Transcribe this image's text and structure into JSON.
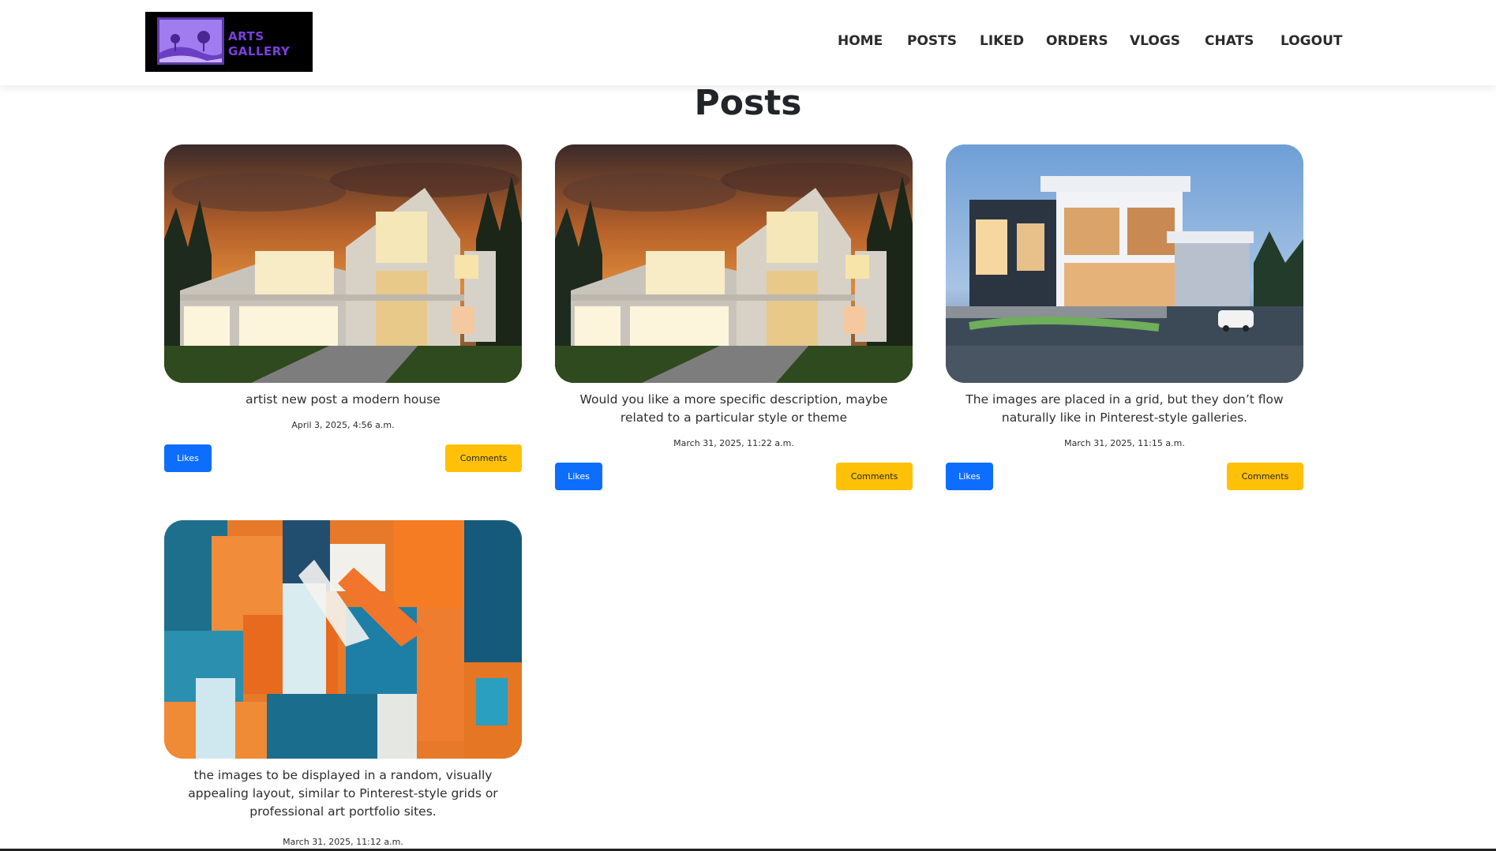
{
  "nav": {
    "logo_line1": "ARTS",
    "logo_line2": "GALLERY",
    "links": [
      "HOME",
      "POSTS",
      "LIKED",
      "ORDERS",
      "VLOGS",
      "CHATS",
      "LOGOUT"
    ]
  },
  "page": {
    "title": "Posts"
  },
  "posts": [
    {
      "description": "artist new post a modern house",
      "date": "April 3, 2025, 4:56 a.m.",
      "likes_label": "Likes",
      "comments_label": "Comments",
      "image": "sunset-modern-house"
    },
    {
      "description": "Would you like a more specific description, maybe related to a particular style or theme",
      "date": "March 31, 2025, 11:22 a.m.",
      "likes_label": "Likes",
      "comments_label": "Comments",
      "image": "sunset-modern-house"
    },
    {
      "description": "The images are placed in a grid, but they don’t flow naturally like in Pinterest-style galleries.",
      "date": "March 31, 2025, 11:15 a.m.",
      "likes_label": "Likes",
      "comments_label": "Comments",
      "image": "dusk-luxury-villa"
    },
    {
      "description": "the images to be displayed in a random, visually appealing layout, similar to Pinterest-style grids or professional art portfolio sites.",
      "date": "March 31, 2025, 11:12 a.m.",
      "image": "abstract-painting"
    }
  ],
  "colors": {
    "likes": "#0d6efd",
    "comments": "#ffc107",
    "logo_bg": "#000000",
    "logo_text": "#7a3fe0"
  }
}
